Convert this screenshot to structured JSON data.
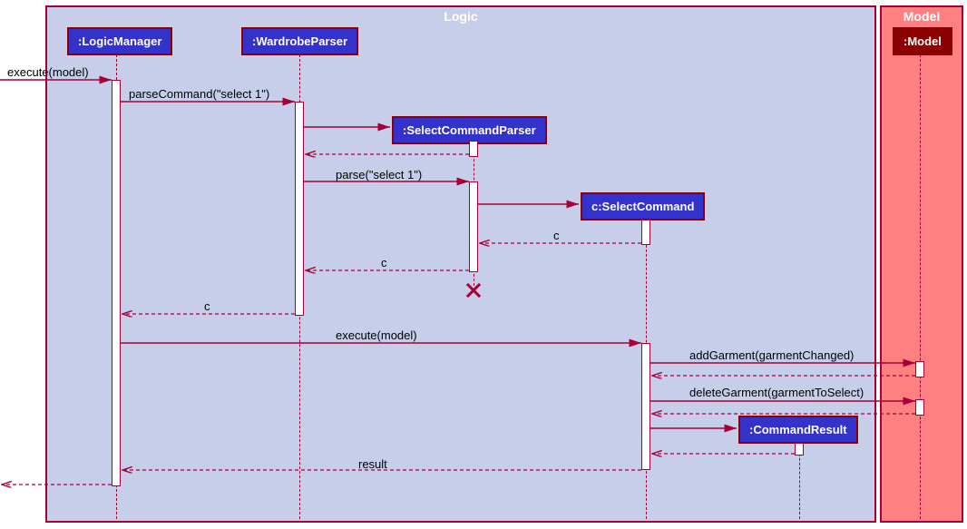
{
  "frames": {
    "logic": "Logic",
    "model": "Model"
  },
  "participants": {
    "logicManager": ":LogicManager",
    "wardrobeParser": ":WardrobeParser",
    "selectCommandParser": ":SelectCommandParser",
    "selectCommand": "c:SelectCommand",
    "commandResult": ":CommandResult",
    "model": ":Model"
  },
  "messages": {
    "executeModel1": "execute(model)",
    "parseCommand": "parseCommand(\"select 1\")",
    "parse": "parse(\"select 1\")",
    "returnC1": "c",
    "returnC2": "c",
    "returnC3": "c",
    "executeModel2": "execute(model)",
    "addGarment": "addGarment(garmentChanged)",
    "deleteGarment": "deleteGarment(garmentToSelect)",
    "result": "result"
  }
}
